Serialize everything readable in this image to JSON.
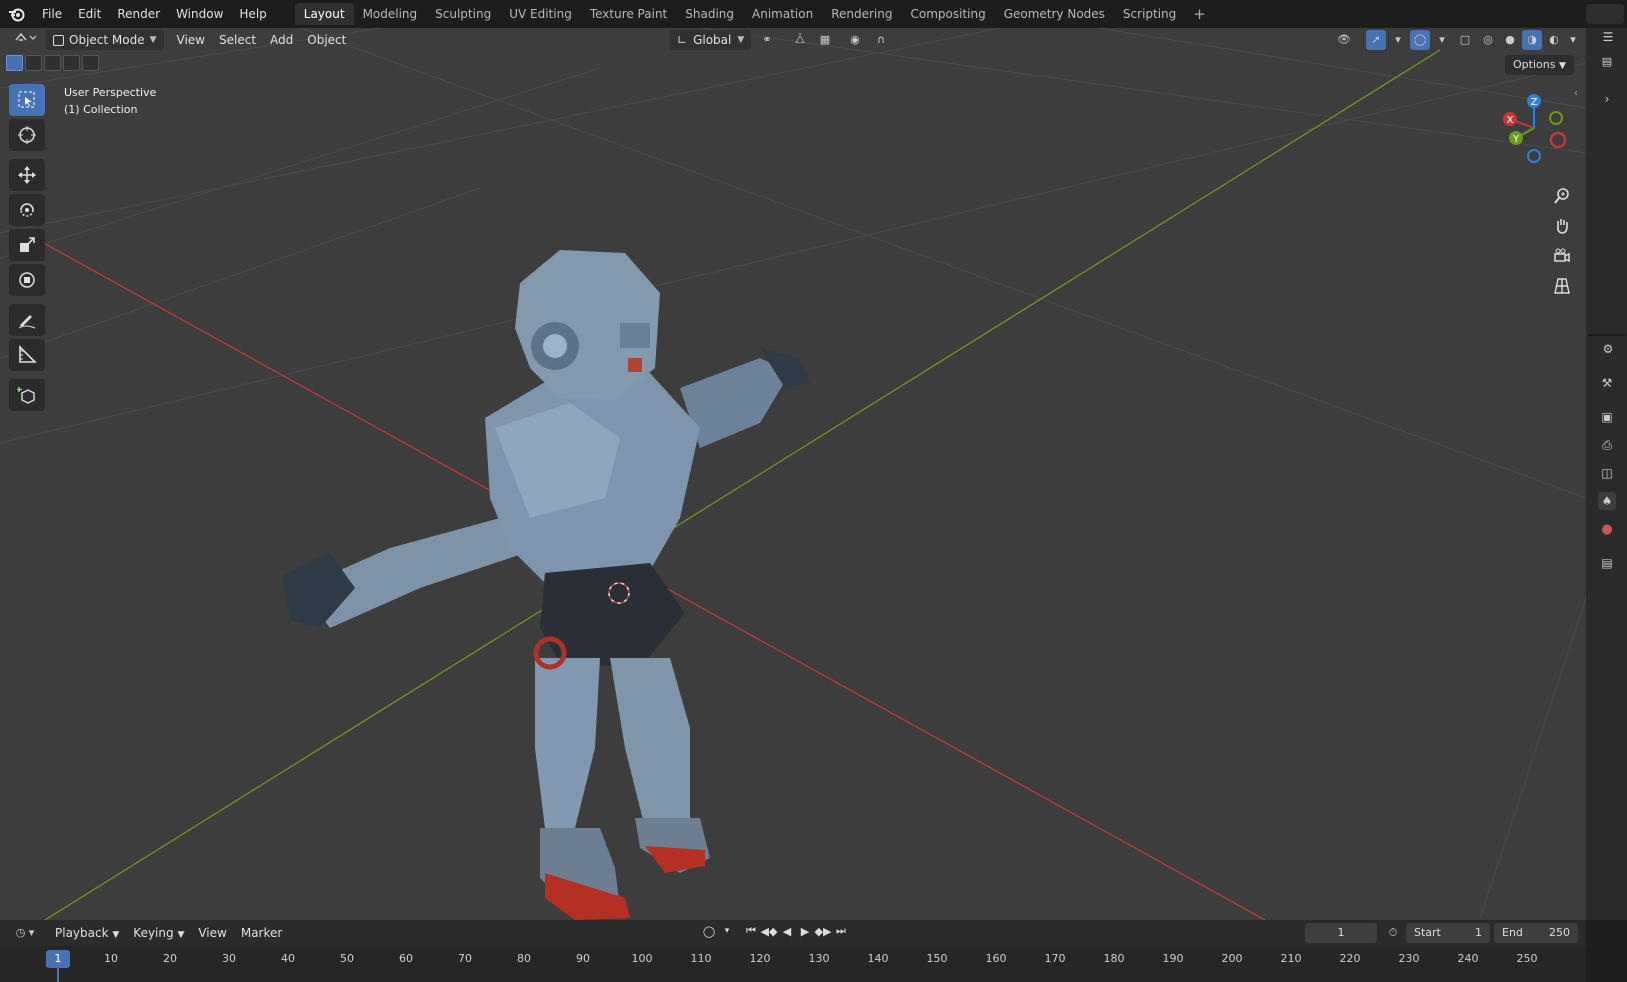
{
  "topbar": {
    "menus": [
      "File",
      "Edit",
      "Render",
      "Window",
      "Help"
    ],
    "workspaces": [
      "Layout",
      "Modeling",
      "Sculpting",
      "UV Editing",
      "Texture Paint",
      "Shading",
      "Animation",
      "Rendering",
      "Compositing",
      "Geometry Nodes",
      "Scripting"
    ],
    "active_workspace": "Layout",
    "add_tab": "+"
  },
  "viewport": {
    "mode": "Object Mode",
    "menus": [
      "View",
      "Select",
      "Add",
      "Object"
    ],
    "orientation": "Global",
    "overlay_line1": "User Perspective",
    "overlay_line2": "(1) Collection",
    "options_label": "Options",
    "gizmo": {
      "z": "Z",
      "x": "X",
      "y": "Y"
    }
  },
  "timeline": {
    "menus": [
      "Playback",
      "Keying",
      "View",
      "Marker"
    ],
    "current_frame": "1",
    "start_label": "Start",
    "start_value": "1",
    "end_label": "End",
    "end_value": "250",
    "ticks": [
      "1",
      "10",
      "20",
      "30",
      "40",
      "50",
      "60",
      "70",
      "80",
      "90",
      "100",
      "110",
      "120",
      "130",
      "140",
      "150",
      "160",
      "170",
      "180",
      "190",
      "200",
      "210",
      "220",
      "230",
      "240",
      "250"
    ]
  },
  "colors": {
    "accent": "#4772b3",
    "viewport_bg": "#3d3d3d",
    "x_axis": "#c0393b",
    "y_axis": "#6a9a22",
    "z_axis": "#2f7fe0"
  }
}
